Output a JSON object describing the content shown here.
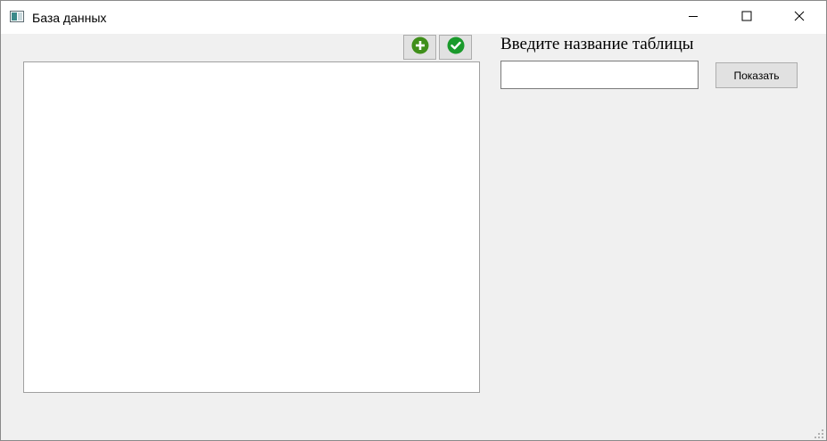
{
  "window": {
    "title": "База данных",
    "controls": {
      "minimize_icon": "minimize-icon",
      "maximize_icon": "maximize-icon",
      "close_icon": "close-icon"
    }
  },
  "toolbar": {
    "add_icon": "plus-circle-icon",
    "confirm_icon": "check-circle-icon",
    "add_color": "#3f8f1a",
    "confirm_color": "#1a9a2c"
  },
  "form": {
    "prompt": "Введите название таблицы",
    "table_name_value": "",
    "show_label": "Показать"
  },
  "colors": {
    "background": "#f0f0f0",
    "titlebar": "#ffffff"
  }
}
